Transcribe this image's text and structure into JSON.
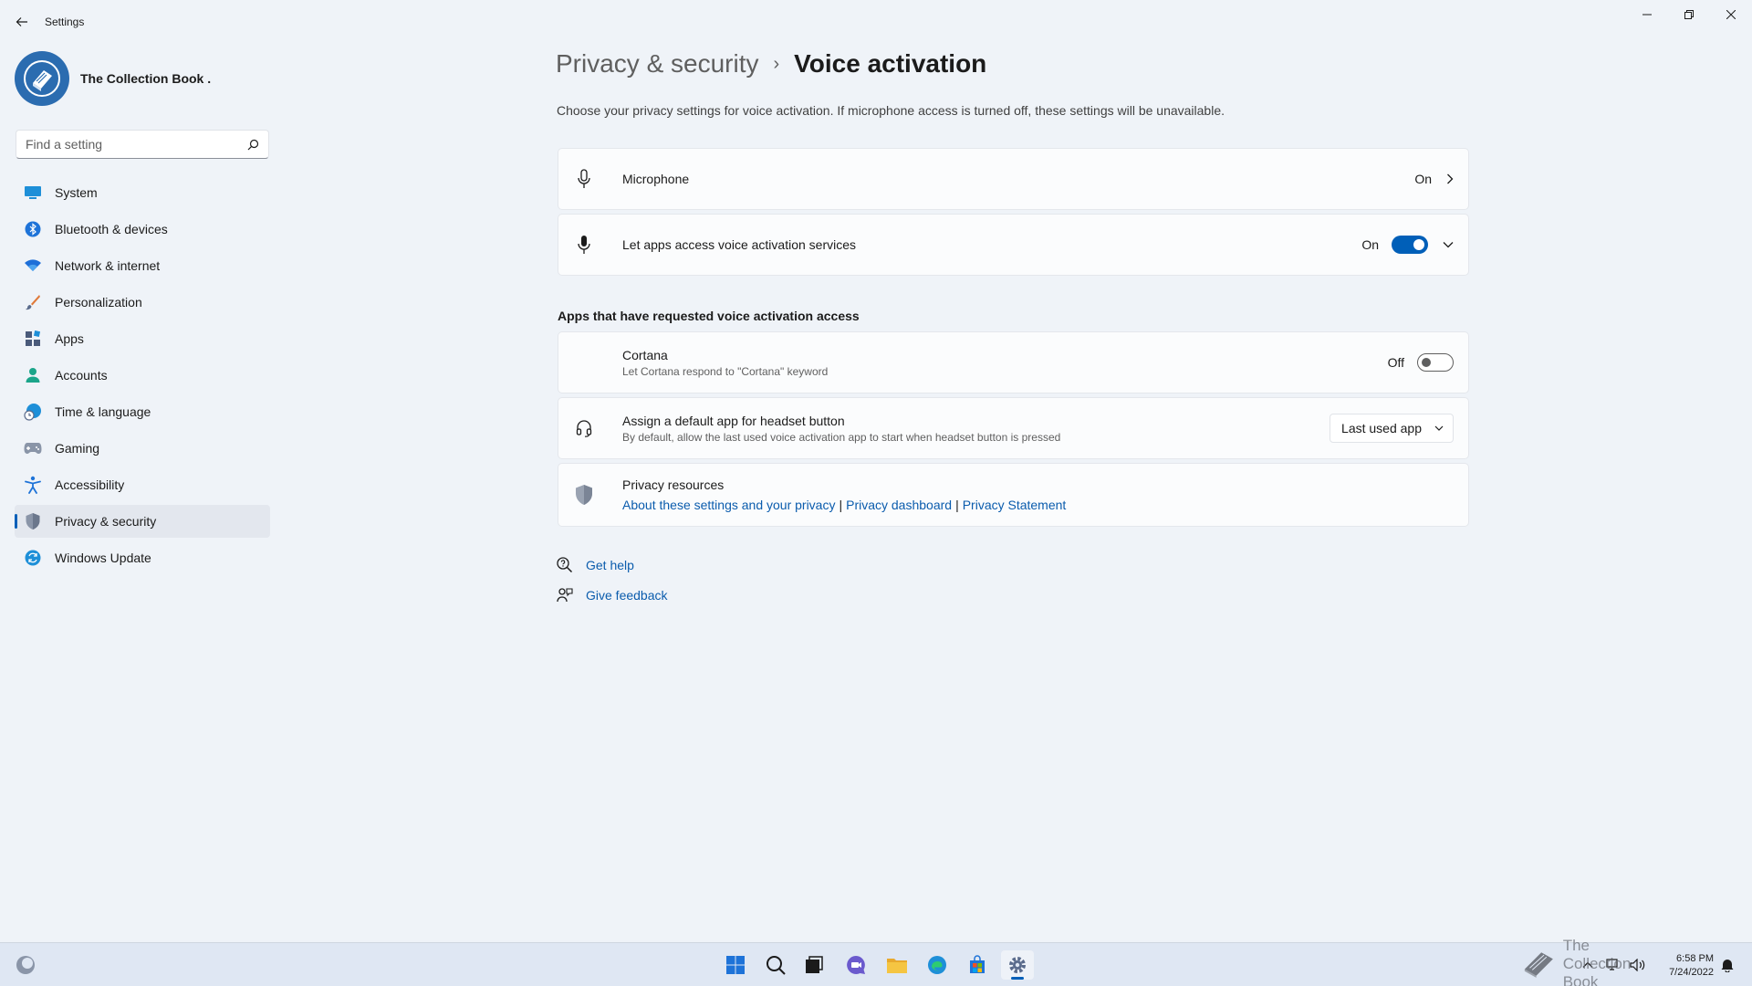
{
  "window": {
    "title": "Settings"
  },
  "profile": {
    "name": "The Collection Book ."
  },
  "search": {
    "placeholder": "Find a setting"
  },
  "sidebar": {
    "items": [
      {
        "label": "System",
        "icon": "monitor-icon"
      },
      {
        "label": "Bluetooth & devices",
        "icon": "bluetooth-icon"
      },
      {
        "label": "Network & internet",
        "icon": "wifi-icon"
      },
      {
        "label": "Personalization",
        "icon": "brush-icon"
      },
      {
        "label": "Apps",
        "icon": "apps-icon"
      },
      {
        "label": "Accounts",
        "icon": "person-icon"
      },
      {
        "label": "Time & language",
        "icon": "globe-clock-icon"
      },
      {
        "label": "Gaming",
        "icon": "gamepad-icon"
      },
      {
        "label": "Accessibility",
        "icon": "accessibility-icon"
      },
      {
        "label": "Privacy & security",
        "icon": "shield-icon",
        "active": true
      },
      {
        "label": "Windows Update",
        "icon": "update-icon"
      }
    ]
  },
  "header": {
    "parent": "Privacy & security",
    "separator": "›",
    "current": "Voice activation",
    "description": "Choose your privacy settings for voice activation. If microphone access is turned off, these settings will be unavailable."
  },
  "microphone": {
    "title": "Microphone",
    "state": "On"
  },
  "voice_access": {
    "title": "Let apps access voice activation services",
    "state": "On",
    "enabled": true
  },
  "apps_section": {
    "title": "Apps that have requested voice activation access"
  },
  "cortana": {
    "title": "Cortana",
    "subtitle": "Let Cortana respond to \"Cortana\" keyword",
    "state": "Off",
    "enabled": false
  },
  "headset": {
    "title": "Assign a default app for headset button",
    "subtitle": "By default, allow the last used voice activation app to start when headset button is pressed",
    "selected": "Last used app"
  },
  "privacy_resources": {
    "title": "Privacy resources",
    "links": [
      "About these settings and your privacy",
      "Privacy dashboard",
      "Privacy Statement"
    ],
    "separator": "|"
  },
  "help": {
    "get_help": "Get help",
    "give_feedback": "Give feedback"
  },
  "taskbar": {
    "time": "6:58 PM",
    "date": "7/24/2022",
    "watermark": "The Collection Book"
  },
  "colors": {
    "accent": "#005fb8",
    "background": "#eff3f8",
    "link": "#0b5cad"
  }
}
